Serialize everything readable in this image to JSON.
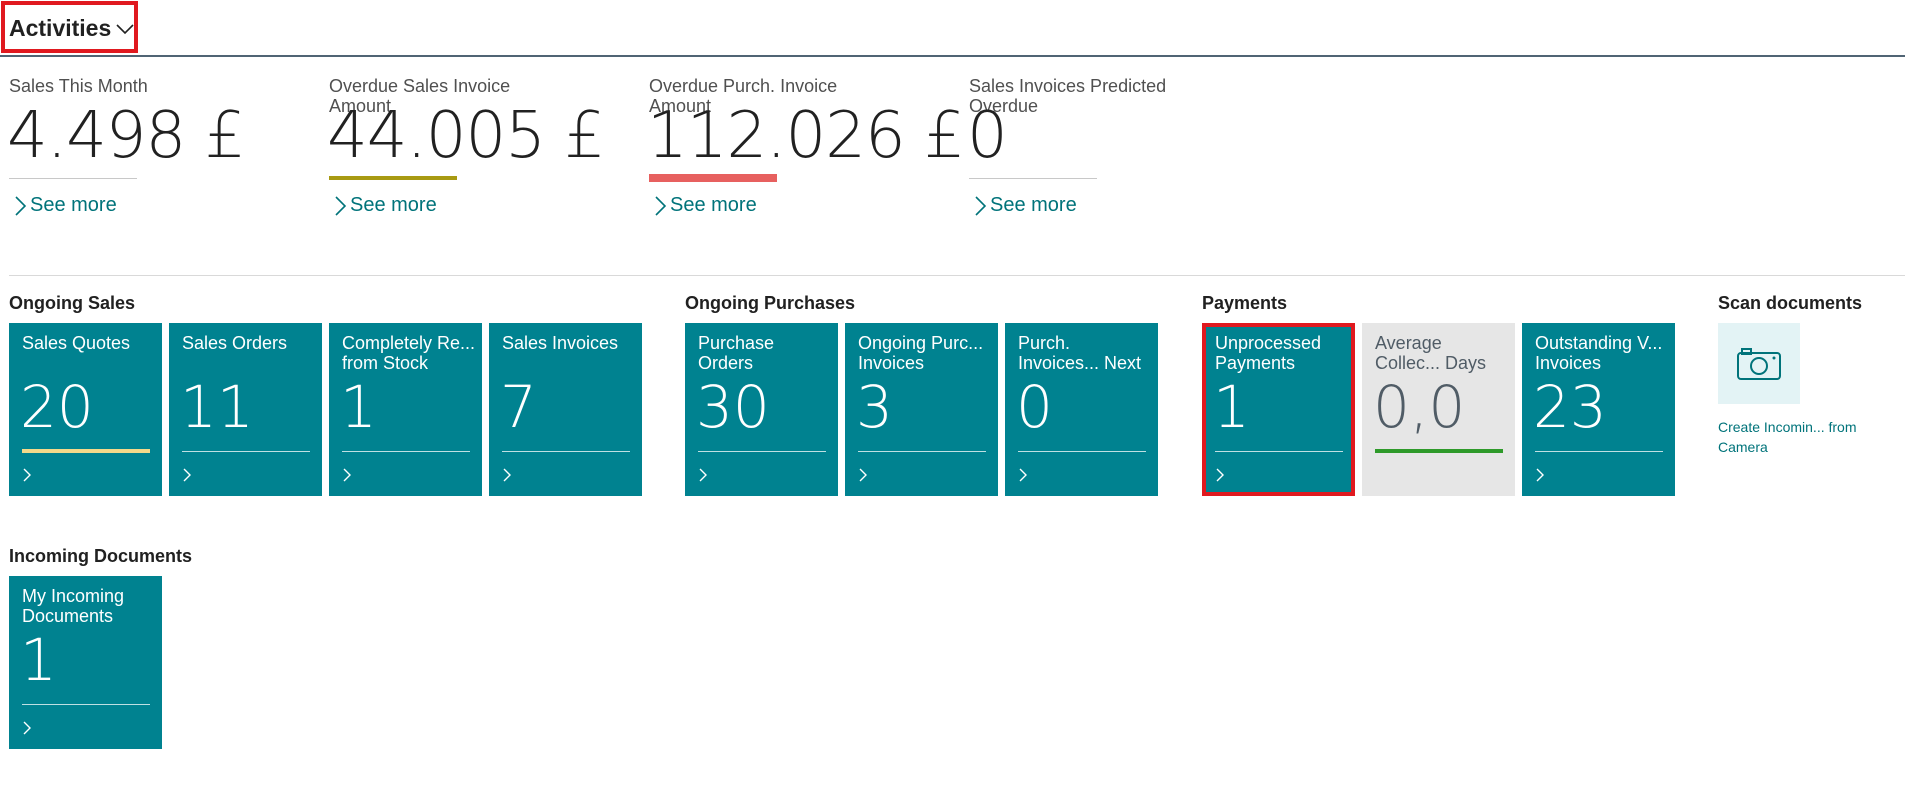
{
  "header": {
    "title": "Activities"
  },
  "kpis": [
    {
      "label": "Sales This Month",
      "value": "4.498 £",
      "bar_color": "#c8c8c8",
      "see_more": "See more"
    },
    {
      "label": "Overdue Sales Invoice Amount",
      "value": "44.005 £",
      "bar_color": "#a89a12",
      "see_more": "See more"
    },
    {
      "label": "Overdue Purch. Invoice Amount",
      "value": "112.026 £",
      "bar_color": "#e7605f",
      "see_more": "See more"
    },
    {
      "label": "Sales Invoices Predicted Overdue",
      "value": "0",
      "bar_color": "#c8c8c8",
      "see_more": "See more"
    }
  ],
  "groups": {
    "ongoing_sales": {
      "title": "Ongoing Sales",
      "tiles": [
        {
          "label": "Sales Quotes",
          "value": "20",
          "indicator": "#f3d98a"
        },
        {
          "label": "Sales Orders",
          "value": "11"
        },
        {
          "label": "Completely Re... from Stock",
          "value": "1"
        },
        {
          "label": "Sales Invoices",
          "value": "7"
        }
      ]
    },
    "ongoing_purchases": {
      "title": "Ongoing Purchases",
      "tiles": [
        {
          "label": "Purchase Orders",
          "value": "30"
        },
        {
          "label": "Ongoing Purc... Invoices",
          "value": "3"
        },
        {
          "label": "Purch. Invoices... Next Week",
          "value": "0"
        }
      ]
    },
    "payments": {
      "title": "Payments",
      "tiles": [
        {
          "label": "Unprocessed Payments",
          "value": "1"
        },
        {
          "label": "Average Collec... Days",
          "value": "0,0",
          "indicator": "#2e9a2a"
        },
        {
          "label": "Outstanding V... Invoices",
          "value": "23"
        }
      ]
    },
    "scan_documents": {
      "title": "Scan documents",
      "action_label": "Create Incomin... from Camera",
      "icon": "camera-icon"
    },
    "incoming_documents": {
      "title": "Incoming Documents",
      "tiles": [
        {
          "label": "My Incoming Documents",
          "value": "1"
        }
      ]
    }
  },
  "colors": {
    "tile": "#008290",
    "tile_grey": "#e6e6e6",
    "link": "#00737a",
    "highlight": "#e0191f"
  }
}
